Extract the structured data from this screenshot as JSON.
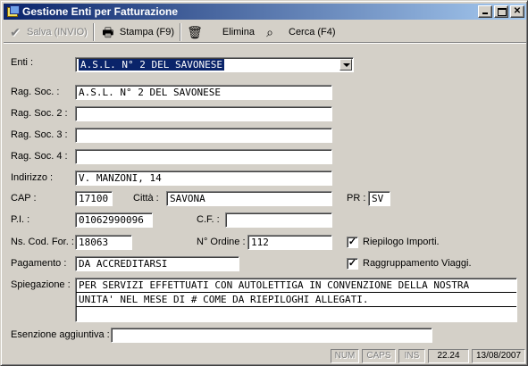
{
  "window": {
    "title": "Gestione Enti per Fatturazione"
  },
  "toolbar": {
    "save": "Salva (INVIO)",
    "print": "Stampa (F9)",
    "delete": "Elimina",
    "search": "Cerca (F4)"
  },
  "form": {
    "enti_label": "Enti :",
    "enti_value": "A.S.L. N° 2 DEL SAVONESE",
    "ragsoc_label": "Rag. Soc. :",
    "ragsoc_value": "A.S.L. N° 2 DEL SAVONESE",
    "ragsoc2_label": "Rag. Soc. 2 :",
    "ragsoc2_value": "",
    "ragsoc3_label": "Rag. Soc. 3 :",
    "ragsoc3_value": "",
    "ragsoc4_label": "Rag. Soc. 4 :",
    "ragsoc4_value": "",
    "indirizzo_label": "Indirizzo :",
    "indirizzo_value": "V. MANZONI, 14",
    "cap_label": "CAP :",
    "cap_value": "17100",
    "citta_label": "Città :",
    "citta_value": "SAVONA",
    "pr_label": "PR :",
    "pr_value": "SV",
    "pi_label": "P.I. :",
    "pi_value": "01062990096",
    "cf_label": "C.F. :",
    "cf_value": "",
    "codfor_label": "Ns. Cod. For. :",
    "codfor_value": "18063",
    "ordine_label": "N° Ordine :",
    "ordine_value": "112",
    "riepilogo_label": "Riepilogo Importi.",
    "riepilogo_checked": true,
    "raggruppamento_label": "Raggruppamento Viaggi.",
    "raggruppamento_checked": true,
    "pagamento_label": "Pagamento :",
    "pagamento_value": "DA ACCREDITARSI",
    "spiegazione_label": "Spiegazione :",
    "spiegazione_lines": [
      "PER SERVIZI EFFETTUATI CON AUTOLETTIGA IN CONVENZIONE DELLA NOSTRA",
      "UNITA' NEL MESE DI # COME DA RIEPILOGHI ALLEGATI.",
      ""
    ],
    "esenzione_label": "Esenzione aggiuntiva :",
    "esenzione_value": ""
  },
  "status": {
    "num": "NUM",
    "caps": "CAPS",
    "ins": "INS",
    "time": "22.24",
    "date": "13/08/2007"
  },
  "icons": {
    "save": "check-icon",
    "print": "printer-icon",
    "delete": "trash-icon",
    "search": "binoculars-icon"
  },
  "colors": {
    "titlebar_start": "#0a246a",
    "titlebar_end": "#a6caf0",
    "face": "#d4d0c8",
    "selection": "#0a246a"
  }
}
